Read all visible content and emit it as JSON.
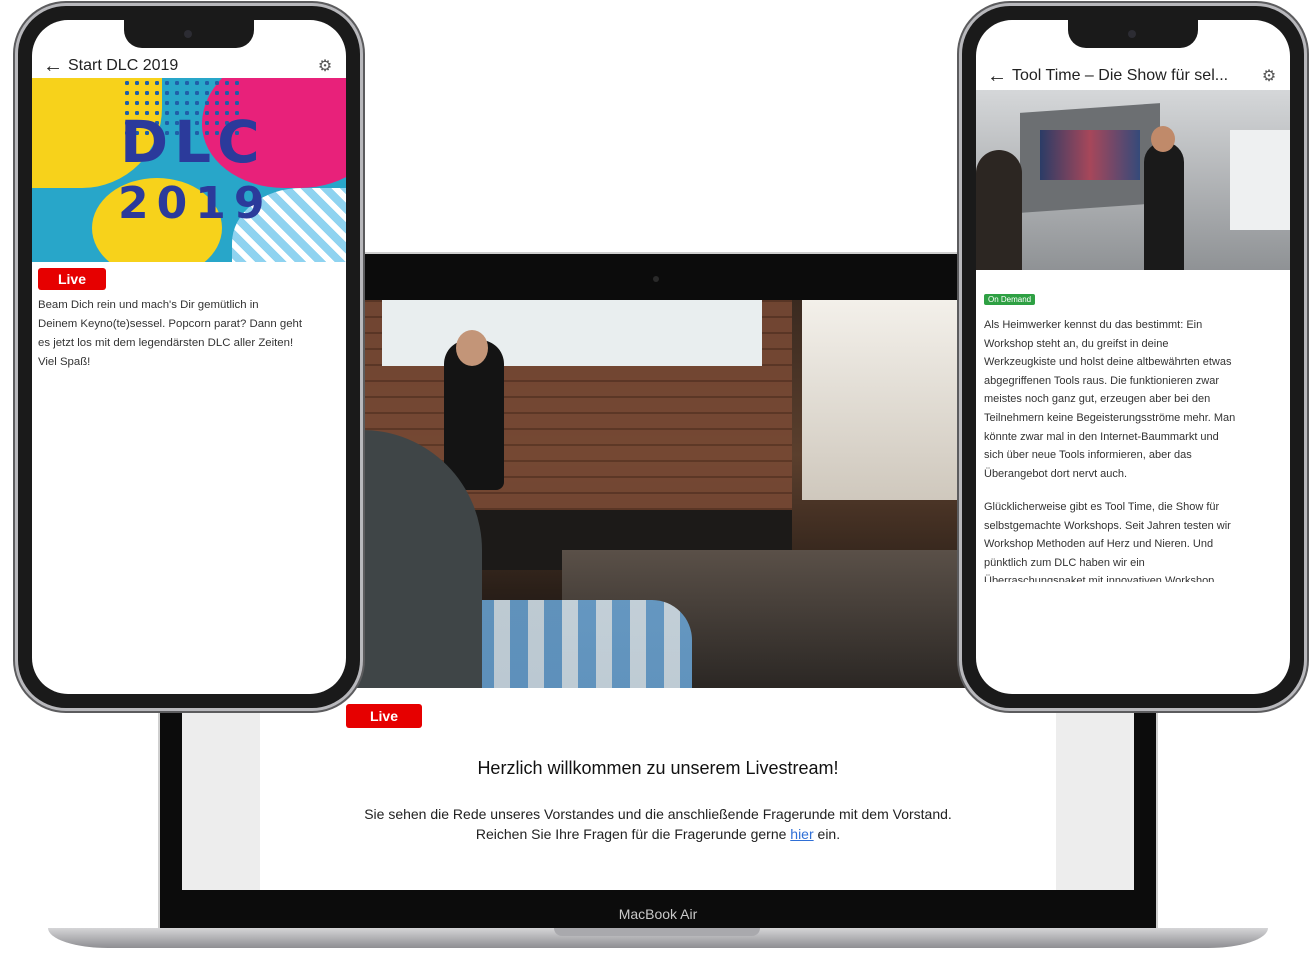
{
  "laptop": {
    "live_badge": "Live",
    "welcome_title": "Herzlich willkommen zu unserem Livestream!",
    "line1": "Sie sehen die Rede unseres Vorstandes und die anschließende Fragerunde mit dem Vorstand.",
    "line2_before": "Reichen Sie Ihre Fragen für die Fragerunde gerne ",
    "line2_link": "hier",
    "line2_after": " ein.",
    "brand": "MacBook Air"
  },
  "phone_left": {
    "title": "Start DLC 2019",
    "back_icon": "arrow-left-icon",
    "settings_icon": "gear-icon",
    "art_line1": "DLC",
    "art_line2": "2019",
    "live_badge": "Live",
    "description_lines": [
      "Beam Dich rein und mach's Dir gemütlich in",
      "Deinem Keyno(te)sessel. Popcorn parat? Dann geht",
      "es jetzt los mit dem legendärsten DLC aller Zeiten!",
      "Viel Spaß!"
    ]
  },
  "phone_right": {
    "title": "Tool Time – Die Show für sel...",
    "back_icon": "arrow-left-icon",
    "settings_icon": "gear-icon",
    "badge": "On Demand",
    "para1_lines": [
      "Als Heimwerker kennst du das bestimmt: Ein",
      "Workshop steht an, du greifst in deine",
      "Werkzeugkiste und holst deine altbewährten etwas",
      "abgegriffenen Tools raus. Die funktionieren zwar",
      "meistes noch ganz gut, erzeugen aber bei den",
      "Teilnehmern keine Begeisterungsströme mehr. Man",
      "könnte zwar mal in den Internet-Baummarkt und",
      "sich über neue Tools informieren, aber das",
      "Überangebot dort nervt auch."
    ],
    "para2_lines": [
      "Glücklicherweise gibt es Tool Time, die Show für",
      "selbstgemachte Workshops. Seit Jahren testen wir",
      "Workshop Methoden auf Herz und Nieren. Und",
      "pünktlich zum DLC haben wir ein",
      "Überraschungspaket mit innovativen Workshop"
    ]
  },
  "colors": {
    "live_red": "#e60000",
    "on_demand_green": "#2ea043",
    "link_blue": "#2f6fd6"
  }
}
